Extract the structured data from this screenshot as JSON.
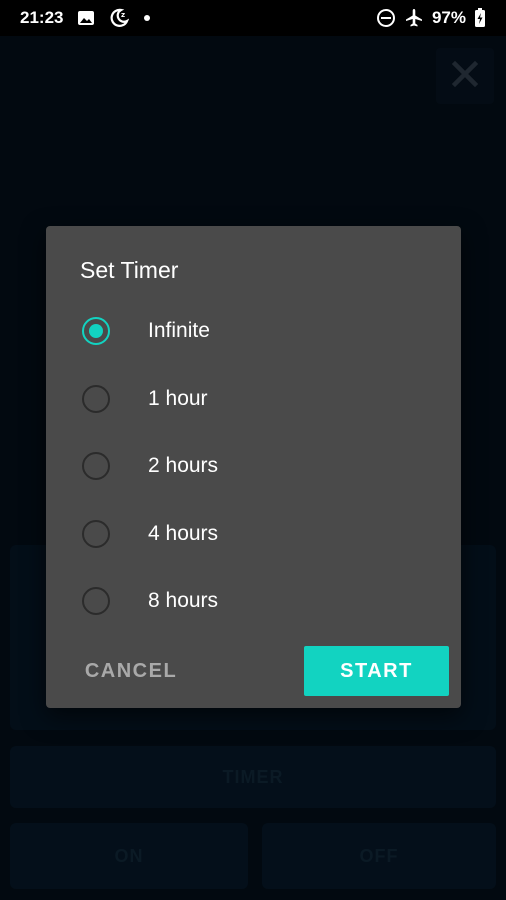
{
  "status_bar": {
    "time": "21:23",
    "battery_percent": "97%",
    "left_icons": [
      "image-icon",
      "do-not-disturb-moon-icon",
      "notification-dot-icon"
    ],
    "right_icons": [
      "dnd-minus-icon",
      "airplane-icon",
      "battery-charging-icon"
    ]
  },
  "background": {
    "close_icon": "close-icon",
    "timer_label": "TIMER",
    "on_label": "ON",
    "off_label": "OFF"
  },
  "dialog": {
    "title": "Set Timer",
    "options": [
      {
        "label": "Infinite",
        "checked": true
      },
      {
        "label": "1 hour",
        "checked": false
      },
      {
        "label": "2 hours",
        "checked": false
      },
      {
        "label": "4 hours",
        "checked": false
      },
      {
        "label": "8 hours",
        "checked": false
      }
    ],
    "cancel_label": "CANCEL",
    "start_label": "START"
  },
  "colors": {
    "accent": "#12d3c1",
    "dialog_bg": "#4a4a4a",
    "app_bg": "#030c16"
  }
}
